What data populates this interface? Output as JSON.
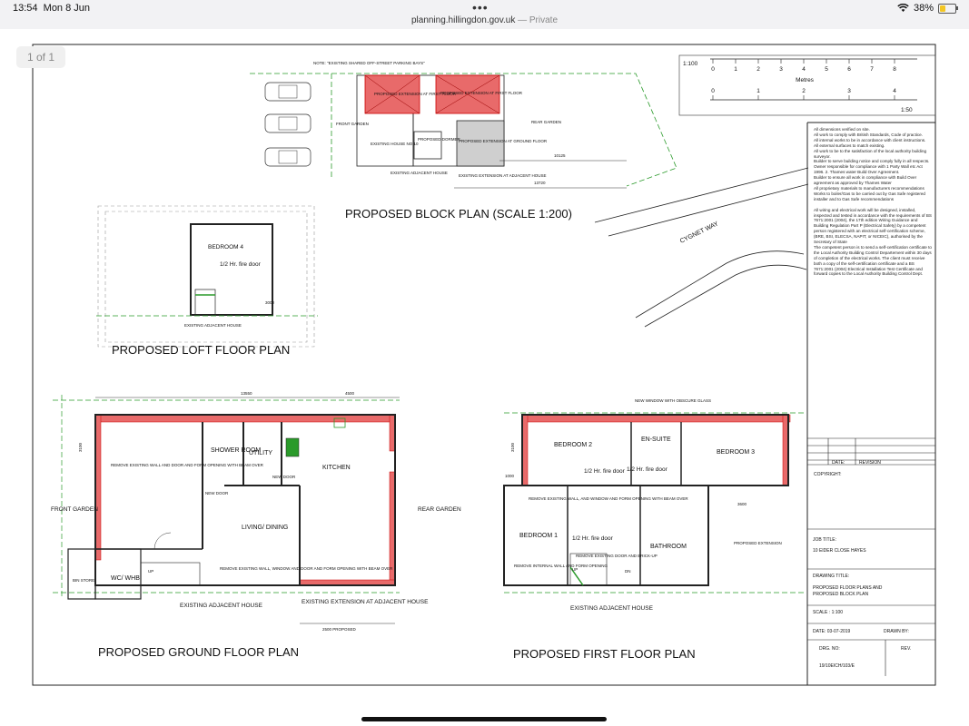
{
  "status": {
    "time": "13:54",
    "date": "Mon 8 Jun",
    "url": "planning.hillingdon.gov.uk",
    "private": "— Private",
    "battery": "38%",
    "battery_level": 0.38
  },
  "viewer": {
    "page_indicator": "1 of 1"
  },
  "drawing": {
    "titles": {
      "block": "PROPOSED BLOCK PLAN (SCALE 1:200)",
      "loft": "PROPOSED LOFT FLOOR PLAN",
      "ground": "PROPOSED GROUND FLOOR PLAN",
      "first": "PROPOSED FIRST FLOOR PLAN"
    },
    "scale_bar": {
      "top_scale": "1:100",
      "bottom_scale": "1:50",
      "unit": "Metres",
      "top_ticks": [
        "0",
        "1",
        "2",
        "3",
        "4",
        "5",
        "6",
        "7",
        "8"
      ],
      "bottom_ticks": [
        "0",
        "1",
        "2",
        "3",
        "4"
      ]
    },
    "block": {
      "note": "NOTE: \"EXISTING SHARED OFF-STREET PARKING BAYS\"",
      "front_garden": "FRONT GARDEN",
      "existing_house": "EXISTING HOUSE NO.10",
      "proposed_ext_first": "PROPOSED EXTENSION AT FIRST FLOOR",
      "proposed_ext_first2": "PROPOSED EXTENSION AT FIRST FLOOR",
      "dormer": "PROPOSED DORMER",
      "proposed_ext_ground": "PROPOSED EXTENSION AT GROUND FLOOR",
      "existing_ext": "EXISTING EXTENSION AT ADJACENT HOUSE",
      "adjacent": "EXISTING ADJACENT HOUSE",
      "rear_garden": "REAR GARDEN",
      "road": "CYGNET WAY",
      "dim1": "10125",
      "dim2": "13720"
    },
    "loft": {
      "bedroom": "BEDROOM 4",
      "door": "1/2 Hr. fire door",
      "adjacent": "EXISTING ADJACENT HOUSE",
      "dim": "3000"
    },
    "ground": {
      "dim_a": "13550",
      "dim_b": "4500",
      "dim_side": "3100",
      "dim_bottom": "2500 PROPOSED",
      "remove_wall": "REMOVE EXISTING WALL AND DOOR AND FORM OPENING WITH BEAM OVER",
      "shower": "SHOWER ROOM",
      "utility": "UTILITY",
      "kitchen": "KITCHEN",
      "new_door1": "NEW DOOR",
      "new_door2": "NEW DOOR",
      "front_garden": "FRONT GARDEN",
      "rear_garden": "REAR GARDEN",
      "living": "LIVING/ DINING",
      "remove_wall2": "REMOVE EXISTING WALL, WINDOW AND DOOR AND FORM OPENING WITH BEAM OVER",
      "wc": "WC/ WHB",
      "bin": "BIN STORE",
      "up": "UP",
      "existing_adjacent": "EXISTING ADJACENT HOUSE",
      "existing_ext": "EXISTING EXTENSION AT ADJACENT HOUSE"
    },
    "first": {
      "new_window": "NEW WINDOW WITH OBSCURE GLASS",
      "bed2": "BEDROOM 2",
      "ensuite": "EN-SUITE",
      "bed3": "BEDROOM 3",
      "fire1": "1/2 Hr. fire door",
      "fire2": "1/2 Hr. fire door",
      "fire3": "1/2 Hr. fire door",
      "remove_wall": "REMOVE EXISTING WALL, AND WINDOW AND FORM OPENING WITH BEAM OVER",
      "bed1": "BEDROOM 1",
      "bathroom": "BATHROOM",
      "remove_internal": "REMOVE INTERNAL WALL AND FORM OPENING",
      "remove_door": "REMOVE EXISTING DOOR AND BRICK-UP",
      "proposed_ext": "PROPOSED EXTENSION",
      "up": "UP",
      "dn": "DN",
      "dim_side": "3100",
      "dim_left": "1000",
      "dim_right": "3600",
      "existing_adjacent": "EXISTING ADJACENT HOUSE"
    },
    "title_block": {
      "notes": "All dimensions verified on site.\nAll work to comply with British Standards, Code of practice.\nAll internal works to be in accordance with client instructions.\nAll external surfaces to match existing.\nAll work to be to the satisfaction of the local authority building surveyor.\nBuilder to serve building notice and comply fully in all respects.\nOwner responsible for compliance with 1 Party Wall etc Act 1996. 2. Thames water Build Over Agreement.\nBuilder to ensure all work in compliance with Build Over agreement as approved by Thames Water\nAll proprietary materials to manufacturers recommendations\nWorks to boiler/Gas to be carried out by Gas Safe registered installer and to Gas Safe recommendations\n\nAll wiring and electrical work will be designed, installed, inspected and tested in accordance with the requirements of BS 7671:2001 (2004), the 17th edition Wiring Guidance and Building Regulation Part P (Electrical Safety) by a competent person registered with an electrical self-certification scheme, (BRE, BSI, ELECSA, NAPIT, or NICEIC), authorised by the Secretary of State\nThe competent person is to send a self-certification certificate to the Local Authority Building Control Departement within 30 days of completion of the electrical works. The client must receive both a copy of the self-certification certificate and a BS 7671:2001 (2004) Electrical Installation Test Certificate and forward copies to the Local Authority Building Control Dept.",
      "date_col": "DATE:",
      "revision_col": "REVISION",
      "copyright": "COPYRIGHT:",
      "job_title_label": "JOB TITLE:",
      "job_title": "10 EIDER CLOSE HAYES",
      "drawing_title_label": "DRAWING TITLE:",
      "drawing_title": "PROPOSED FLOOR PLANS AND PROPOSED BLOCK PLAN",
      "scale": "SCALE : 1:100",
      "date": "DATE: 03-07-2019",
      "drawn_by": "DRAWN BY:",
      "drg_no_label": "DRG. NO:",
      "rev_label": "REV.",
      "drg_no": "19/10EICH/103/E"
    }
  }
}
